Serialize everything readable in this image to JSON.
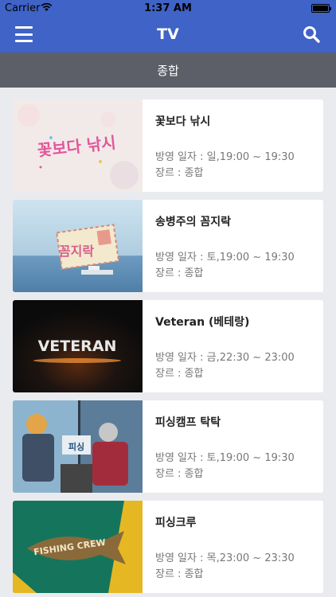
{
  "status_bar": {
    "carrier": "Carrier",
    "time": "1:37 AM"
  },
  "nav": {
    "title": "TV",
    "menu_icon": "hamburger-menu-icon",
    "search_icon": "search-icon"
  },
  "category": {
    "label": "종합"
  },
  "programs": [
    {
      "title": "꽃보다 낚시",
      "airtime": "방영 일자 : 일,19:00 ~ 19:30",
      "genre": "장르 : 종합",
      "thumb_text": "꽃보다 낚시"
    },
    {
      "title": "송병주의 꼼지락",
      "airtime": "방영 일자 : 토,19:00 ~ 19:30",
      "genre": "장르 : 종합",
      "thumb_text": "꼼지락"
    },
    {
      "title": "Veteran (베테랑)",
      "airtime": "방영 일자 : 금,22:30 ~ 23:00",
      "genre": "장르 : 종합",
      "thumb_text": "VETERAN"
    },
    {
      "title": "피싱캠프 탁탁",
      "airtime": "방영 일자 : 토,19:00 ~ 19:30",
      "genre": "장르 : 종합",
      "thumb_text": "피싱"
    },
    {
      "title": "피싱크루",
      "airtime": "방영 일자 : 목,23:00 ~ 23:30",
      "genre": "장르 : 종합",
      "thumb_text": "FISHING CREW"
    }
  ],
  "colors": {
    "nav_bg": "#3f63c6",
    "category_bg": "#5d5f68",
    "page_bg": "#eaebef"
  }
}
